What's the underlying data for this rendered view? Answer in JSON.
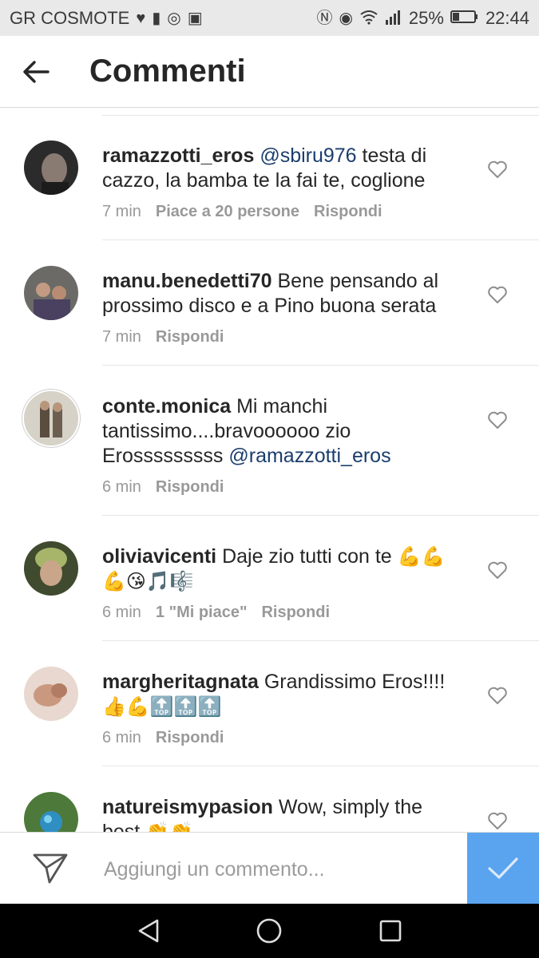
{
  "statusbar": {
    "carrier": "GR COSMOTE",
    "battery": "25%",
    "time": "22:44"
  },
  "header": {
    "title": "Commenti"
  },
  "comments": [
    {
      "username": "ramazzotti_eros",
      "mention": "@sbiru976",
      "text": " testa di cazzo, la bamba te la fai te, coglione",
      "time": "7 min",
      "likes": "Piace a 20 persone",
      "reply": "Rispondi"
    },
    {
      "username": "manu.benedetti70",
      "text": " Bene pensando al prossimo disco e a Pino buona serata",
      "time": "7 min",
      "reply": "Rispondi"
    },
    {
      "username": "conte.monica",
      "text": " Mi manchi tantissimo....bravoooooo zio Erosssssssss ",
      "mention": "@ramazzotti_eros",
      "time": "6 min",
      "reply": "Rispondi"
    },
    {
      "username": "oliviavicenti",
      "text": " Daje zio tutti con te ",
      "emoji": "💪💪 💪😘🎵🎼",
      "time": "6 min",
      "likes": "1 \"Mi piace\"",
      "reply": "Rispondi"
    },
    {
      "username": "margheritagnata",
      "text": " Grandissimo Eros!!!! ",
      "emoji": "👍💪🔝🔝🔝",
      "time": "6 min",
      "reply": "Rispondi"
    },
    {
      "username": "natureismypasion",
      "text": " Wow, simply the best ",
      "emoji": "👏👏"
    }
  ],
  "composer": {
    "placeholder": "Aggiungi un commento..."
  },
  "colors": {
    "post_button": "#5aa4ef",
    "mention": "#1b3d6e"
  }
}
